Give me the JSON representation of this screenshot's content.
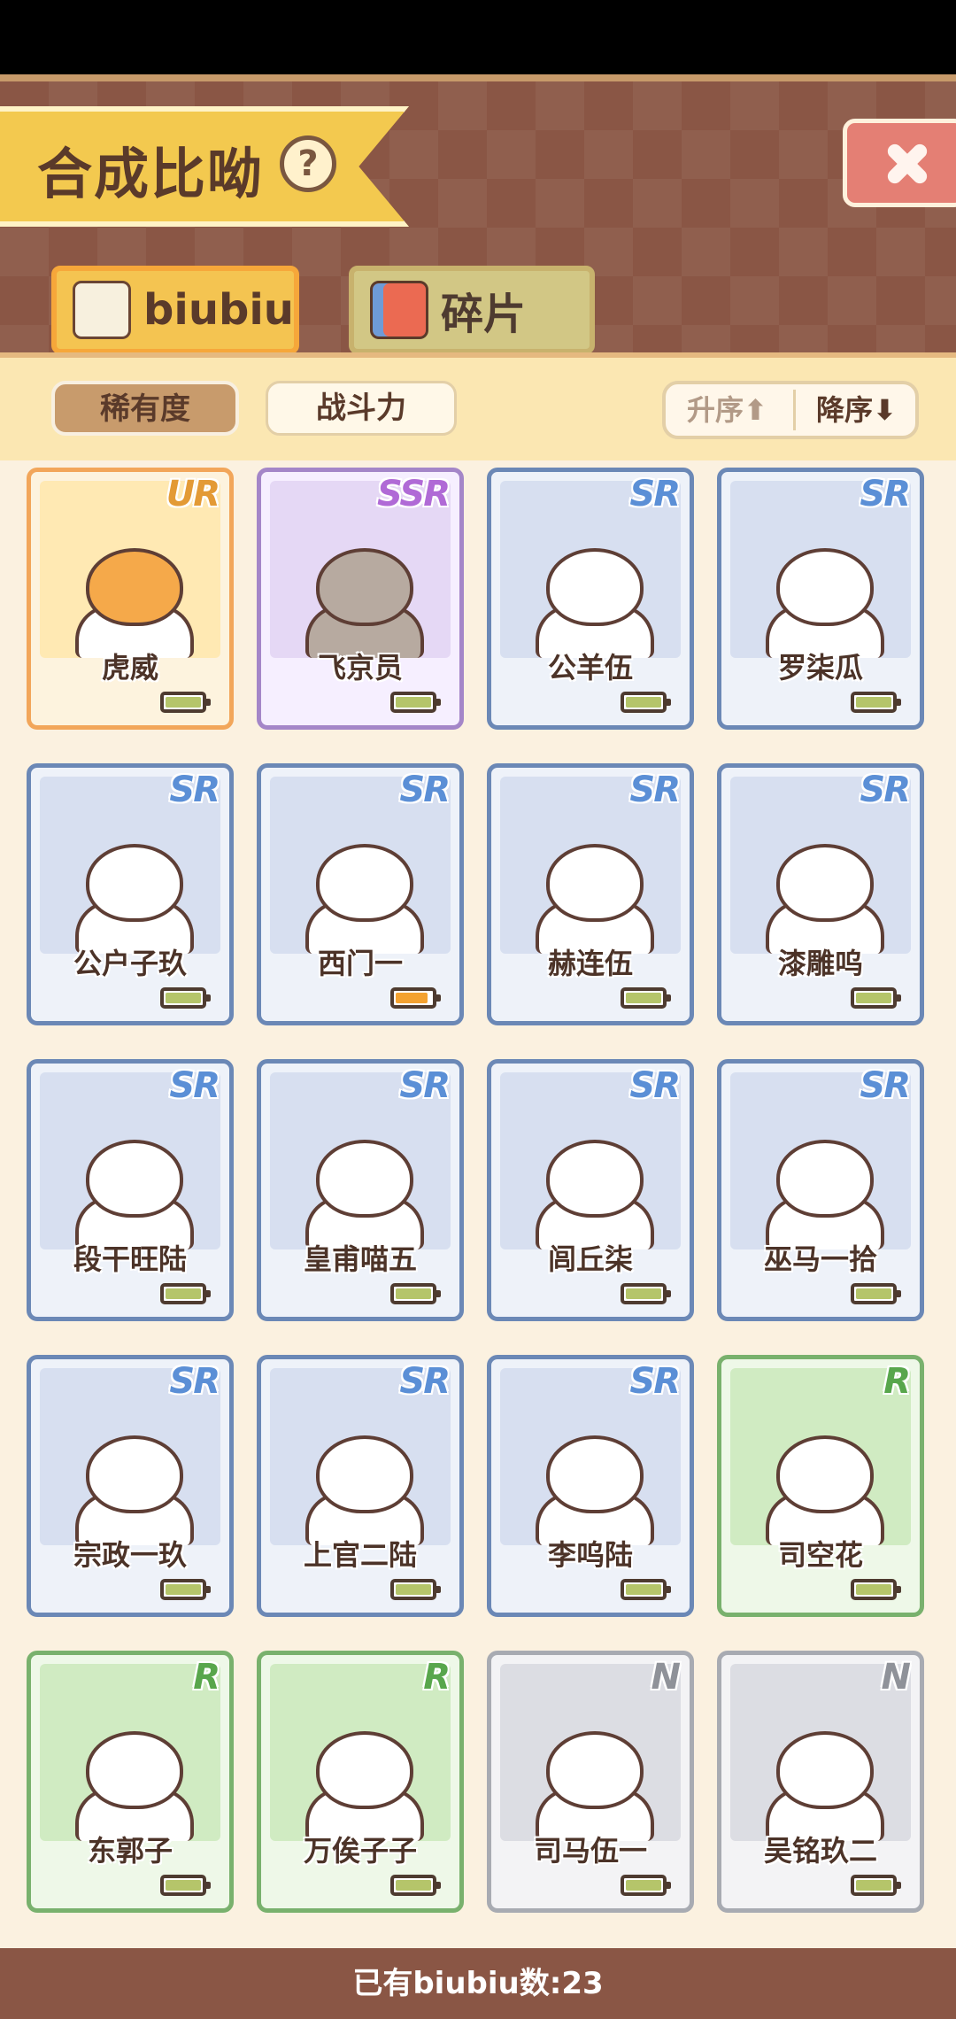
{
  "header": {
    "title": "合成比呦",
    "help_icon": "?"
  },
  "tabs": [
    {
      "label": "biubiu",
      "active": true,
      "icon": "cat-icon"
    },
    {
      "label": "碎片",
      "active": false,
      "icon": "fragment-icon"
    }
  ],
  "filters": {
    "rarity_label": "稀有度",
    "power_label": "战斗力",
    "asc_label": "升序⬆",
    "desc_label": "降序⬇"
  },
  "cards": [
    {
      "name": "虎威",
      "rarity": "UR",
      "battery": "full"
    },
    {
      "name": "飞京员",
      "rarity": "SSR",
      "battery": "full"
    },
    {
      "name": "公羊伍",
      "rarity": "SR",
      "battery": "full"
    },
    {
      "name": "罗柒瓜",
      "rarity": "SR",
      "battery": "full"
    },
    {
      "name": "公户子玖",
      "rarity": "SR",
      "battery": "full"
    },
    {
      "name": "西门一",
      "rarity": "SR",
      "battery": "orange"
    },
    {
      "name": "赫连伍",
      "rarity": "SR",
      "battery": "full"
    },
    {
      "name": "漆雕呜",
      "rarity": "SR",
      "battery": "full"
    },
    {
      "name": "段干旺陆",
      "rarity": "SR",
      "battery": "full"
    },
    {
      "name": "皇甫喵五",
      "rarity": "SR",
      "battery": "full"
    },
    {
      "name": "闾丘柒",
      "rarity": "SR",
      "battery": "full"
    },
    {
      "name": "巫马一拾",
      "rarity": "SR",
      "battery": "full"
    },
    {
      "name": "宗政一玖",
      "rarity": "SR",
      "battery": "full"
    },
    {
      "name": "上官二陆",
      "rarity": "SR",
      "battery": "full"
    },
    {
      "name": "李呜陆",
      "rarity": "SR",
      "battery": "full"
    },
    {
      "name": "司空花",
      "rarity": "R",
      "battery": "full"
    },
    {
      "name": "东郭子",
      "rarity": "R",
      "battery": "full"
    },
    {
      "name": "万俟子子",
      "rarity": "R",
      "battery": "full"
    },
    {
      "name": "司马伍一",
      "rarity": "N",
      "battery": "full"
    },
    {
      "name": "吴铭玖二",
      "rarity": "N",
      "battery": "full"
    }
  ],
  "footer": {
    "count_text": "已有biubiu数:23"
  }
}
